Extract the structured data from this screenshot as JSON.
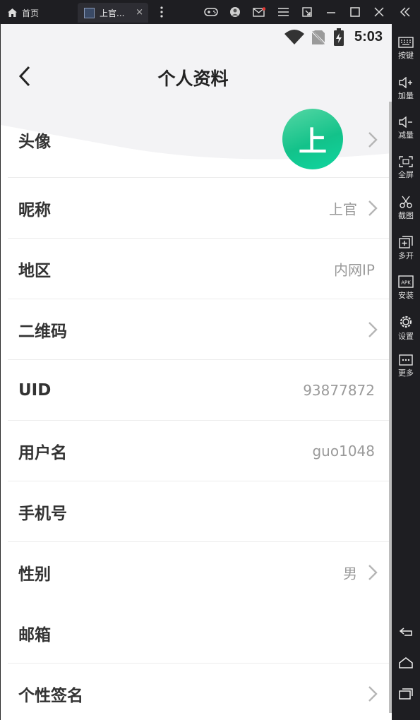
{
  "emulator": {
    "home_tab_label": "首页",
    "app_tab_label": "上官...",
    "tab_close": "×",
    "toolbar_icons": [
      "gamepad-icon",
      "account-icon",
      "mail-icon",
      "menu-icon",
      "popout-icon",
      "minimize-icon",
      "maximize-icon",
      "close-icon",
      "collapse-icon"
    ]
  },
  "sidebar": {
    "items": [
      {
        "icon": "keyboard-icon",
        "label": "按键"
      },
      {
        "icon": "volume-up-icon",
        "label": "加量"
      },
      {
        "icon": "volume-down-icon",
        "label": "减量"
      },
      {
        "icon": "fullscreen-icon",
        "label": "全屏"
      },
      {
        "icon": "scissors-icon",
        "label": "截图"
      },
      {
        "icon": "multi-instance-icon",
        "label": "多开"
      },
      {
        "icon": "apk-icon",
        "label": "安装"
      },
      {
        "icon": "settings-icon",
        "label": "设置"
      },
      {
        "icon": "more-icon",
        "label": "更多"
      }
    ],
    "nav": [
      "back-icon",
      "home-icon",
      "recents-icon"
    ]
  },
  "status_bar": {
    "time": "5:03",
    "icons": [
      "wifi-icon",
      "no-sim-icon",
      "battery-charging-icon"
    ]
  },
  "header": {
    "title": "个人资料"
  },
  "profile": {
    "avatar": {
      "label": "头像",
      "avatar_text": "上",
      "accent": "#13c28a"
    },
    "nickname": {
      "label": "昵称",
      "value": "上官"
    },
    "region": {
      "label": "地区",
      "value": "内网IP"
    },
    "qrcode": {
      "label": "二维码"
    },
    "uid": {
      "label": "UID",
      "value": "93877872"
    },
    "username": {
      "label": "用户名",
      "value": "guo1048"
    },
    "phone": {
      "label": "手机号"
    },
    "gender": {
      "label": "性别",
      "value": "男"
    },
    "email": {
      "label": "邮箱"
    },
    "signature": {
      "label": "个性签名"
    }
  }
}
